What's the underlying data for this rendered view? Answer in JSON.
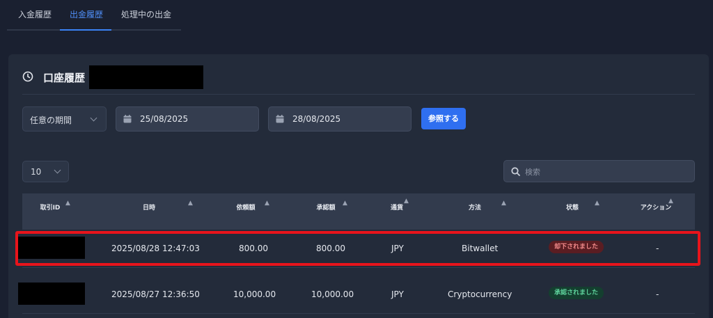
{
  "tabs": [
    {
      "label": "入金履歴",
      "active": false
    },
    {
      "label": "出金履歴",
      "active": true
    },
    {
      "label": "処理中の出金",
      "active": false
    }
  ],
  "card": {
    "title": "口座履歴",
    "icon": "clock-icon"
  },
  "filters": {
    "period": "任意の期間",
    "date_from": "25/08/2025",
    "date_to": "28/08/2025",
    "submit": "参照する"
  },
  "table_controls": {
    "per_page": "10",
    "search_placeholder": "検索"
  },
  "table": {
    "headers": [
      "取引ID",
      "日時",
      "依頼額",
      "承認額",
      "通貨",
      "方法",
      "状態",
      "アクション"
    ],
    "rows": [
      {
        "id": "",
        "datetime": "2025/08/28 12:47:03",
        "requested": "800.00",
        "approved": "800.00",
        "currency": "JPY",
        "method": "Bitwallet",
        "status": "却下されました",
        "action": "-"
      },
      {
        "id": "",
        "datetime": "2025/08/27 12:36:50",
        "requested": "10,000.00",
        "approved": "10,000.00",
        "currency": "JPY",
        "method": "Cryptocurrency",
        "status": "承認されました",
        "action": "-"
      }
    ]
  },
  "colors": {
    "accent": "#3b82f6",
    "highlight": "#e8141b",
    "rejected": "#f08a8a",
    "approved": "#5ed39c"
  }
}
